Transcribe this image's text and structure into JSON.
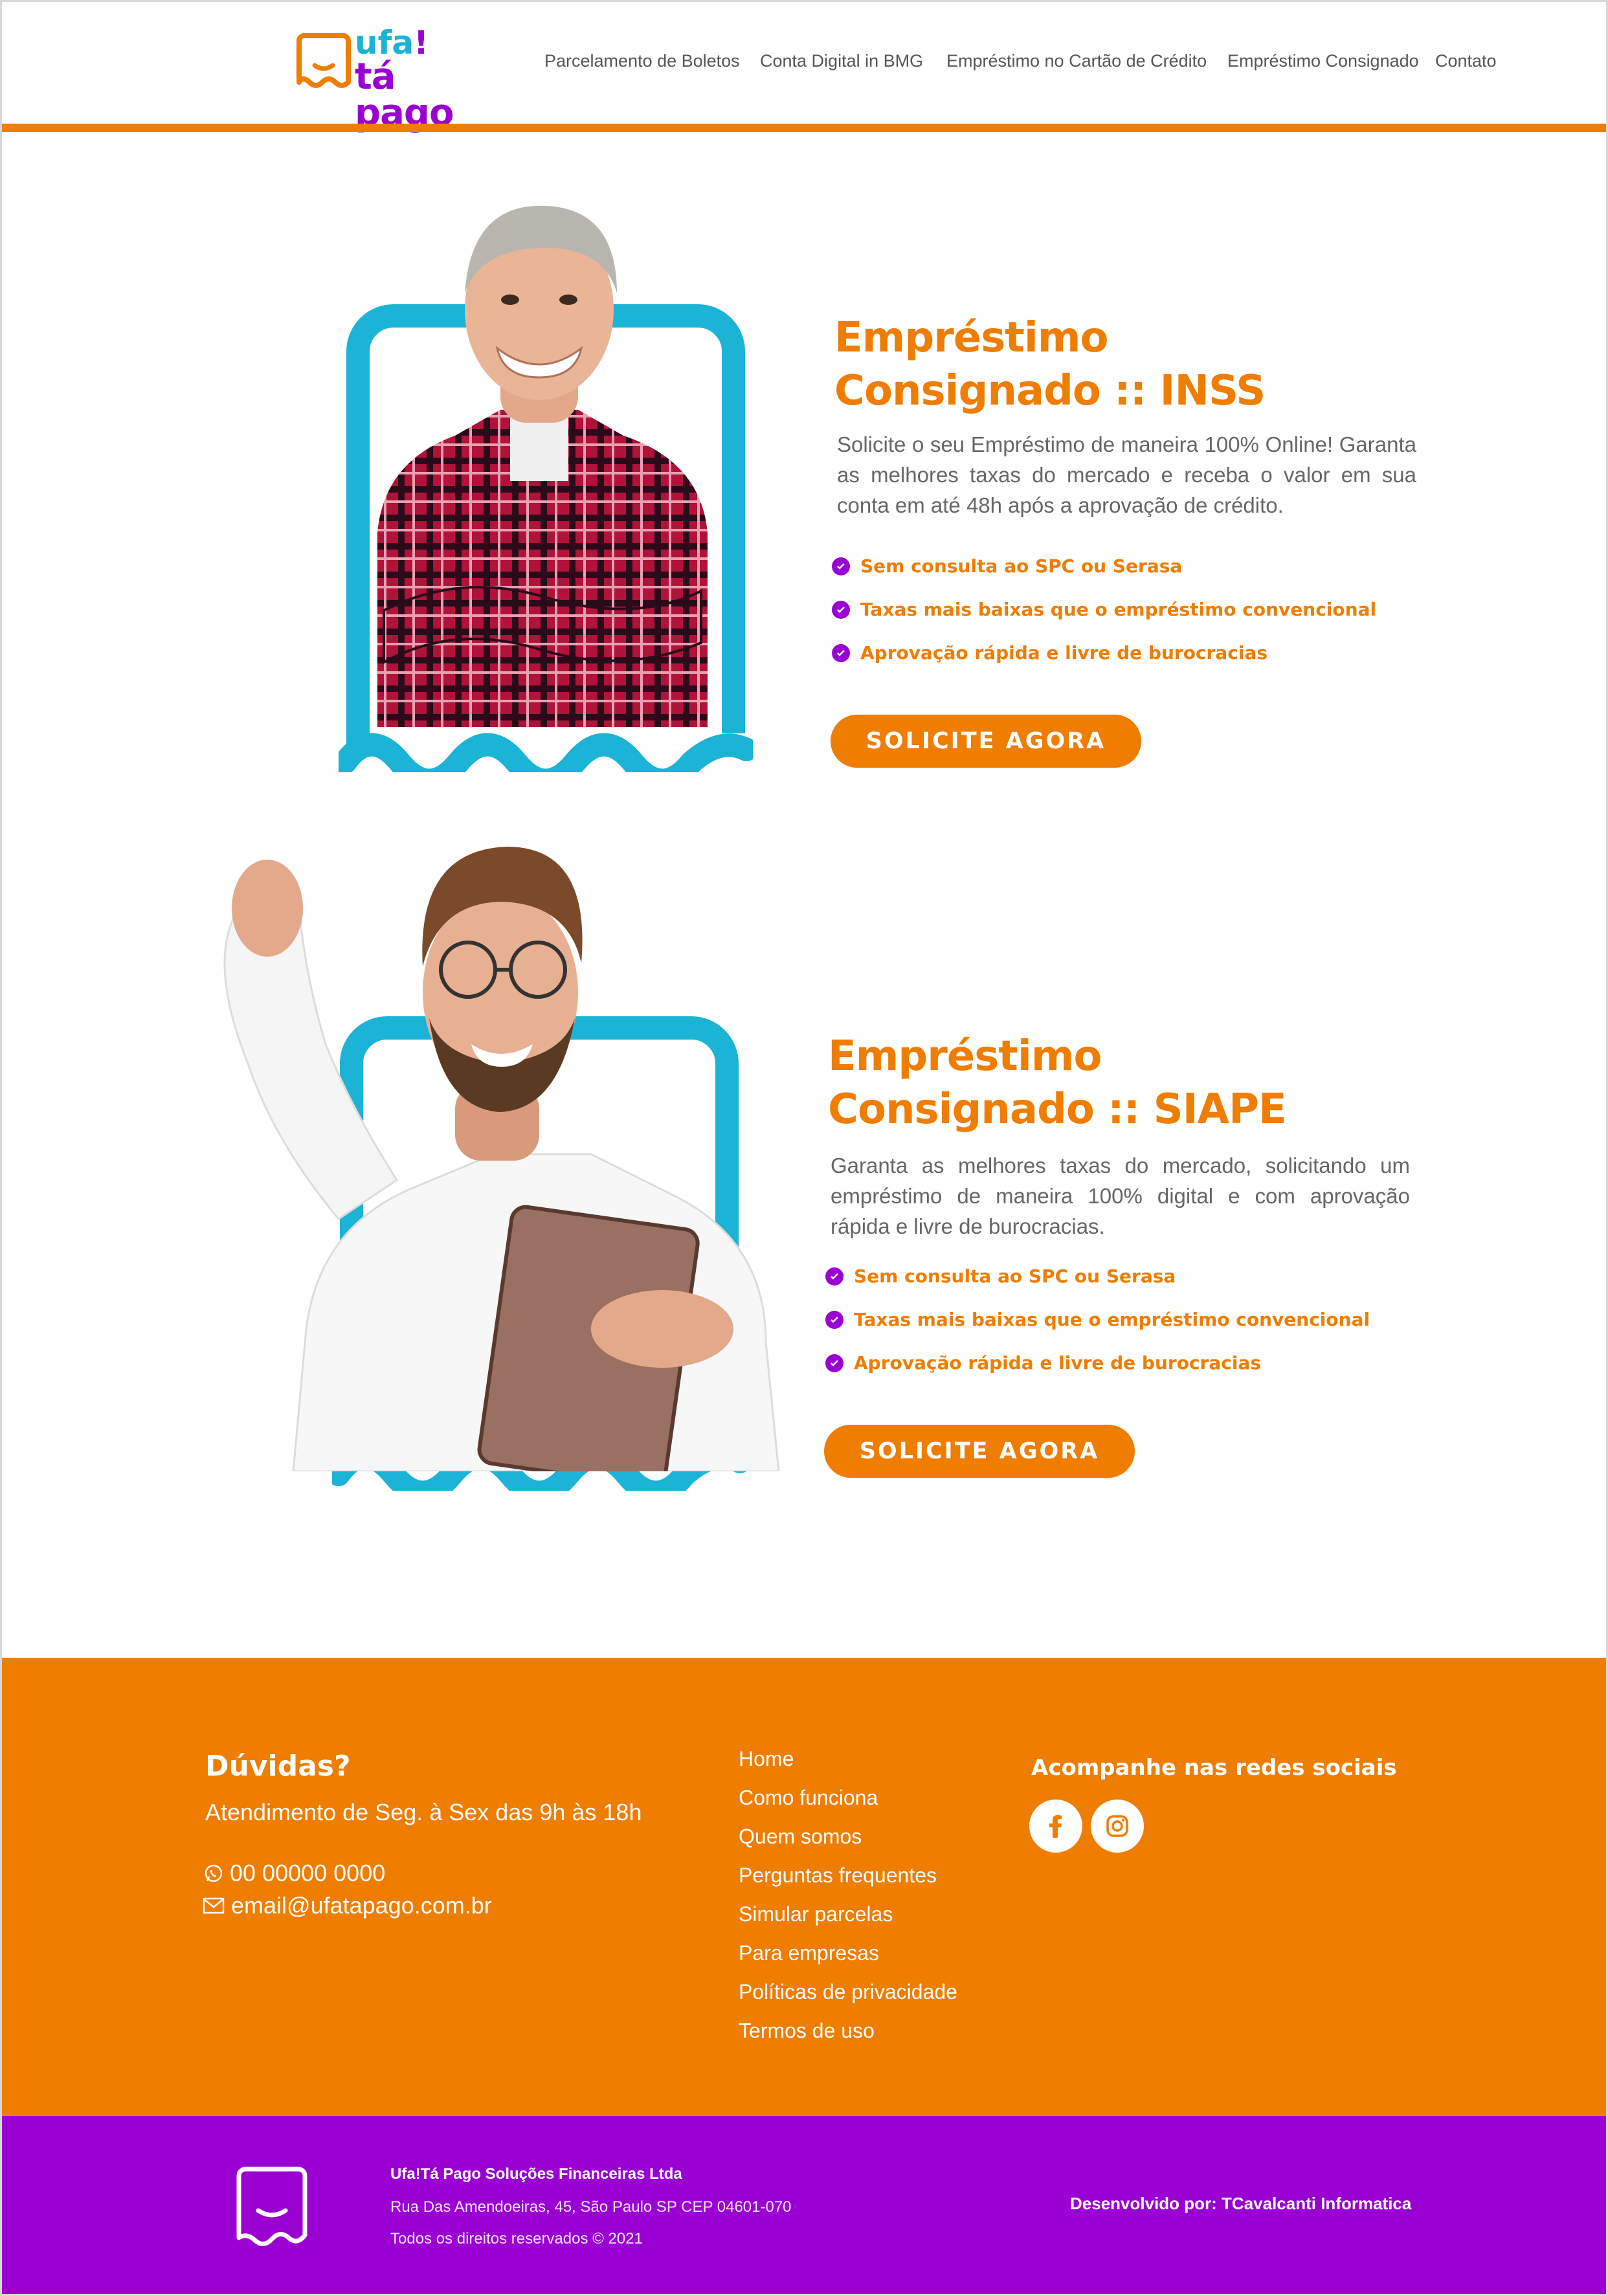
{
  "colors": {
    "orange": "#ef7d00",
    "purple": "#9b00d3",
    "cyan": "#1bb3d6"
  },
  "header": {
    "logo": {
      "line1": "ufa",
      "mark": "!",
      "line2": "tá pago"
    },
    "nav": [
      "Parcelamento de Boletos",
      "Conta Digital in BMG",
      "Empréstimo no Cartão de Crédito",
      "Empréstimo Consignado",
      "Contato"
    ]
  },
  "sections": [
    {
      "title_line1": "Empréstimo",
      "title_line2": "Consignado :: INSS",
      "description": "Solicite o seu Empréstimo de maneira 100% Online! Garanta as melhores taxas do mercado e receba o valor em sua conta em até 48h após a aprovação de crédito.",
      "bullets": [
        "Sem consulta ao SPC ou Serasa",
        "Taxas mais baixas que o empréstimo convencional",
        "Aprovação rápida e livre de burocracias"
      ],
      "cta": "SOLICITE AGORA"
    },
    {
      "title_line1": "Empréstimo",
      "title_line2": "Consignado :: SIAPE",
      "description": "Garanta as melhores taxas do mercado, solicitando um empréstimo de maneira 100% digital e com aprovação rápida e livre de burocracias.",
      "bullets": [
        "Sem consulta ao SPC ou Serasa",
        "Taxas mais baixas que o empréstimo convencional",
        "Aprovação rápida e livre de burocracias"
      ],
      "cta": "SOLICITE AGORA"
    }
  ],
  "footer": {
    "heading": "Dúvidas?",
    "hours": "Atendimento de Seg. à Sex das 9h às 18h",
    "phone": "00 00000 0000",
    "email": "email@ufatapago.com.br",
    "links": [
      "Home",
      "Como funciona",
      "Quem somos",
      "Perguntas frequentes",
      "Simular parcelas",
      "Para empresas",
      "Políticas de privacidade",
      "Termos de uso"
    ],
    "social_heading": "Acompanhe nas redes sociais",
    "social": [
      "facebook-icon",
      "instagram-icon"
    ]
  },
  "bottom": {
    "company": "Ufa!Tá Pago Soluções Financeiras Ltda",
    "address": "Rua Das Amendoeiras, 45, São Paulo SP CEP 04601-070",
    "rights": "Todos os direitos reservados © 2021",
    "developer": "Desenvolvido por: TCavalcanti Informatica"
  }
}
